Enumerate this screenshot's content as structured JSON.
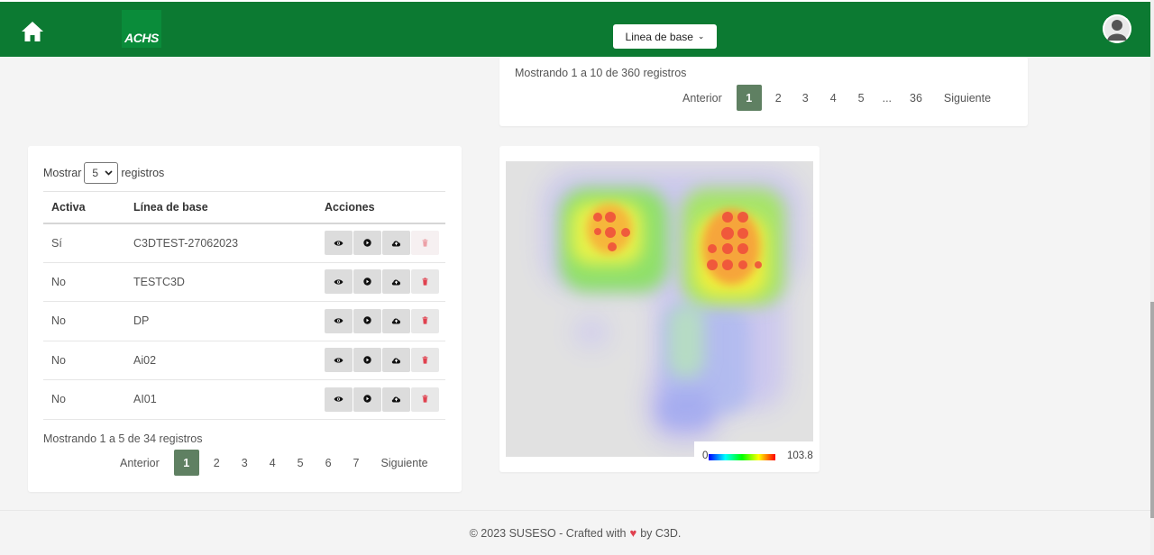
{
  "header": {
    "logo_text": "ACHS",
    "baseline_dropdown_label": "Linea de base",
    "colors": {
      "bar": "#0c7a32",
      "accent": "#5f8062",
      "danger": "#e0414f"
    }
  },
  "top_card": {
    "info": "Mostrando 1 a 10 de 360 registros",
    "pagination": {
      "prev": "Anterior",
      "pages": [
        "1",
        "2",
        "3",
        "4",
        "5",
        "...",
        "36"
      ],
      "next": "Siguiente",
      "current": "1"
    }
  },
  "table_card": {
    "show_prefix": "Mostrar",
    "show_value": "5",
    "show_suffix": "registros",
    "columns": [
      "Activa",
      "Línea de base",
      "Acciones"
    ],
    "rows": [
      {
        "active": "Sí",
        "baseline": "C3DTEST-27062023"
      },
      {
        "active": "No",
        "baseline": "TESTC3D"
      },
      {
        "active": "No",
        "baseline": "DP"
      },
      {
        "active": "No",
        "baseline": "Ai02"
      },
      {
        "active": "No",
        "baseline": "AI01"
      }
    ],
    "info": "Mostrando 1 a 5 de 34 registros",
    "pagination": {
      "prev": "Anterior",
      "pages": [
        "1",
        "2",
        "3",
        "4",
        "5",
        "6",
        "7"
      ],
      "next": "Siguiente",
      "current": "1"
    }
  },
  "heatmap": {
    "legend_min": "0",
    "legend_max": "103.8"
  },
  "footer": {
    "prefix": "© 2023 SUSESO - Crafted with",
    "suffix": "by C3D."
  }
}
